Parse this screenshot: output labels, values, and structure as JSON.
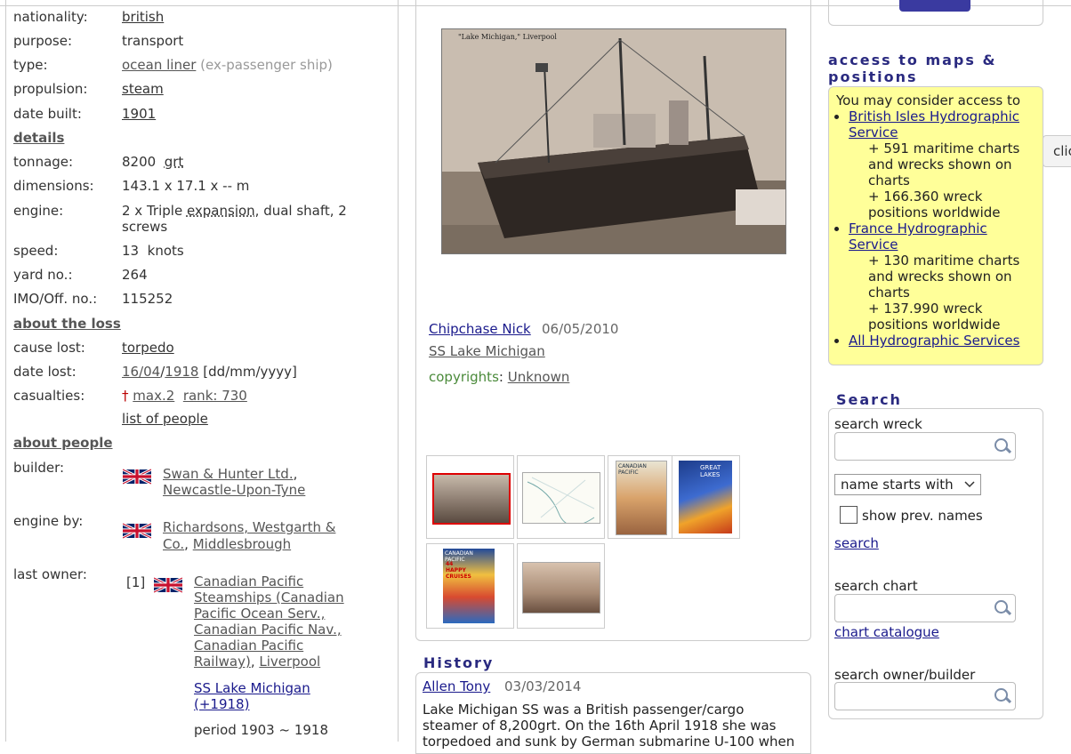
{
  "vessel": {
    "nationality_label": "nationality:",
    "nationality": "british",
    "purpose_label": "purpose:",
    "purpose": "transport",
    "type_label": "type:",
    "type": "ocean liner",
    "type_note": "(ex-passenger ship)",
    "propulsion_label": "propulsion:",
    "propulsion": "steam",
    "date_built_label": "date built:",
    "date_built": "1901",
    "details_heading": "details",
    "tonnage_label": "tonnage:",
    "tonnage": "8200",
    "tonnage_unit": "grt",
    "dimensions_label": "dimensions:",
    "dimensions": "143.1 x 17.1 x -- m",
    "engine_label": "engine:",
    "engine_pre": "2 x Triple ",
    "engine_link": "expansion",
    "engine_post": ", dual shaft, 2",
    "engine_line2": "screws",
    "speed_label": "speed:",
    "speed": "13",
    "speed_unit": "knots",
    "yard_label": "yard no.:",
    "yard": "264",
    "imo_label": "IMO/Off. no.:",
    "imo": "115252"
  },
  "loss": {
    "heading": "about the loss",
    "cause_label": "cause lost:",
    "cause": "torpedo",
    "date_label": "date lost:",
    "date_day": "16/04",
    "date_sep": "/",
    "date_year": "1918",
    "date_fmt": "[dd/mm/yyyy]",
    "casualties_label": "casualties:",
    "cross": "†",
    "casualties_max": "max.2",
    "rank": "rank: 730",
    "list_people": "list of people"
  },
  "people": {
    "heading": "about people",
    "builder_label": "builder:",
    "builder_name": "Swan & Hunter Ltd.",
    "builder_comma": ",",
    "builder_place": "Newcastle-Upon-Tyne",
    "engine_by_label": "engine by:",
    "engine_by_l1": "Richardsons, Westgarth &",
    "engine_by_l2a": "Co.",
    "engine_by_sep": ", ",
    "engine_by_l2b": "Middlesbrough",
    "owner_label": "last owner:",
    "owner_index": "[1]",
    "owner_lines": [
      "Canadian Pacific",
      "Steamships (Canadian",
      "Pacific Ocean Serv.,",
      "Canadian Pacific Nav.,",
      "Canadian Pacific"
    ],
    "owner_last": "Railway)",
    "owner_sep": ", ",
    "owner_place": "Liverpool",
    "ship_name": "SS Lake Michigan",
    "ship_year": "(+1918)",
    "period": "period 1903 ~ 1918"
  },
  "photo": {
    "caption_text": "\"Lake Michigan,\" Liverpool",
    "author": "Chipchase Nick",
    "date": "06/05/2010",
    "title": "SS Lake Michigan",
    "copyright_label": "copyrights",
    "copyright_colon": ": ",
    "copyright_value": "Unknown"
  },
  "thumbs": {
    "t3_title": "CANADIAN PACIFIC",
    "t4_title": "GREAT LAKES",
    "t5_title": "CANADIAN PACIFIC",
    "t5_sub": "44 HAPPY CRUISES"
  },
  "history": {
    "title": "History",
    "author": "Allen Tony",
    "date": "03/03/2014",
    "line1": "Lake Michigan SS was a British passenger/cargo",
    "line2": "steamer of 8,200grt. On the 16th April 1918 she was",
    "line3": "torpedoed and sunk by German submarine U-100 when"
  },
  "maps": {
    "title": "access to maps & positions",
    "intro": "You may consider access to",
    "item1": "British Isles Hydrographic Service",
    "item1_charts": "+ 591 maritime charts and wrecks shown on charts",
    "item1_positions": "+ 166.360 wreck positions worldwide",
    "item2": "France Hydrographic Service",
    "item2_charts": "+ 130 maritime charts and wrecks shown on charts",
    "item2_positions": "+ 137.990 wreck positions worldwide",
    "item3": "All Hydrographic Services"
  },
  "search": {
    "title": "Search",
    "wreck_label": "search wreck",
    "mode_selected": "name starts with",
    "prev_names": "show prev. names",
    "search_link": "search",
    "chart_label": "search chart",
    "chart_catalogue": "chart catalogue",
    "owner_label": "search owner/builder"
  },
  "side_button": "clic",
  "colors": {
    "link_blue": "#1a1a8c",
    "heading_blue": "#2a2a80",
    "yellow_panel": "#ffff99",
    "copyright_green": "#4a8a3a",
    "cross_red": "#b00000"
  }
}
